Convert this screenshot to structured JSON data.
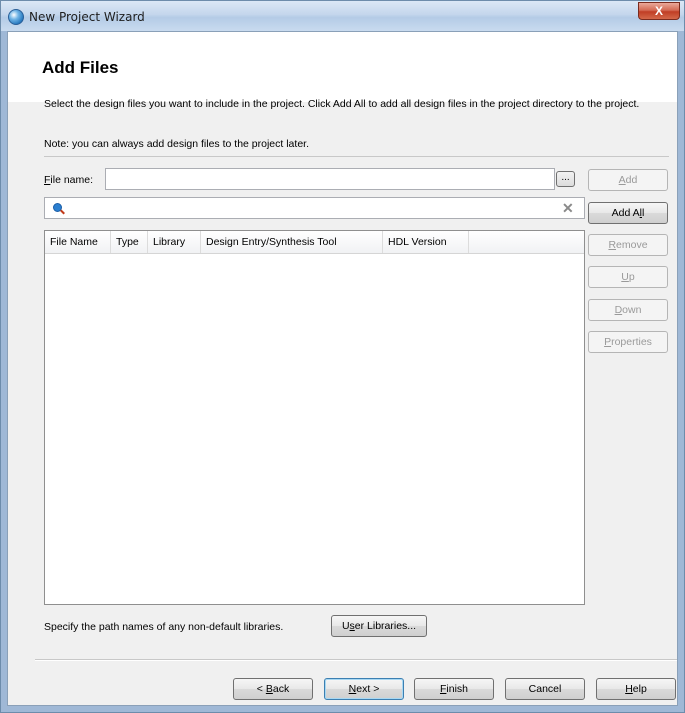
{
  "window": {
    "title": "New Project Wizard",
    "close_label": "X"
  },
  "header": {
    "title": "Add Files",
    "description": "Select the design files you want to include in the project. Click Add All to add all design files in the project directory to the project.",
    "note": "Note: you can always add design files to the project later."
  },
  "file_name": {
    "label_prefix": "F",
    "label_rest": "ile name:",
    "value": "",
    "browse_label": "..."
  },
  "filter": {
    "value": "",
    "search_icon": "search-icon",
    "clear_icon": "clear-icon"
  },
  "table": {
    "columns": [
      "File Name",
      "Type",
      "Library",
      "Design Entry/Synthesis Tool",
      "HDL Version"
    ],
    "rows": []
  },
  "side_buttons": {
    "add": {
      "pre": "",
      "u": "A",
      "post": "dd"
    },
    "add_all": {
      "pre": "Add A",
      "u": "l",
      "post": "l"
    },
    "remove": {
      "pre": "",
      "u": "R",
      "post": "emove"
    },
    "up": {
      "pre": "",
      "u": "U",
      "post": "p"
    },
    "down": {
      "pre": "",
      "u": "D",
      "post": "own"
    },
    "properties": {
      "pre": "",
      "u": "P",
      "post": "roperties"
    }
  },
  "libraries": {
    "text": "Specify the path names of any non-default libraries.",
    "button": {
      "pre": "U",
      "u": "s",
      "post": "er Libraries..."
    }
  },
  "footer": {
    "back": {
      "pre": "< ",
      "u": "B",
      "post": "ack"
    },
    "next": {
      "pre": "",
      "u": "N",
      "post": "ext >"
    },
    "finish": {
      "pre": "",
      "u": "F",
      "post": "inish"
    },
    "cancel": {
      "pre": "Cancel",
      "u": "",
      "post": ""
    },
    "help": {
      "pre": "",
      "u": "H",
      "post": "elp"
    }
  },
  "colors": {
    "titlebar": "#c4d6ec",
    "close_button": "#c03e25",
    "dialog_bg": "#f0f0f0",
    "focus_border": "#3c7fb1"
  }
}
